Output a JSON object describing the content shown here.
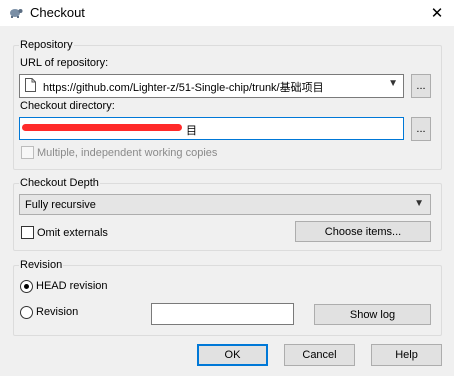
{
  "window": {
    "title": "Checkout",
    "close_glyph": "✕",
    "icon": "tortoise-icon"
  },
  "repository": {
    "group_label": "Repository",
    "url_label": "URL of repository:",
    "url_value": "https://github.com/Lighter-z/51-Single-chip/trunk/基础项目",
    "url_browse": "...",
    "dir_label": "Checkout directory:",
    "dir_visible_tail": "目",
    "dir_browse": "...",
    "multiple_label": "Multiple, independent working copies",
    "multiple_checked": false,
    "multiple_enabled": false
  },
  "depth": {
    "group_label": "Checkout Depth",
    "selected": "Fully recursive",
    "omit_label": "Omit externals",
    "omit_checked": false,
    "choose_items": "Choose items..."
  },
  "revision": {
    "group_label": "Revision",
    "head_label": "HEAD revision",
    "head_selected": true,
    "revision_label": "Revision",
    "revision_value": "",
    "show_log": "Show log"
  },
  "buttons": {
    "ok": "OK",
    "cancel": "Cancel",
    "help": "Help"
  },
  "colors": {
    "accent": "#0078d7",
    "redaction": "#ff2a2a",
    "background": "#f0f0f0"
  }
}
